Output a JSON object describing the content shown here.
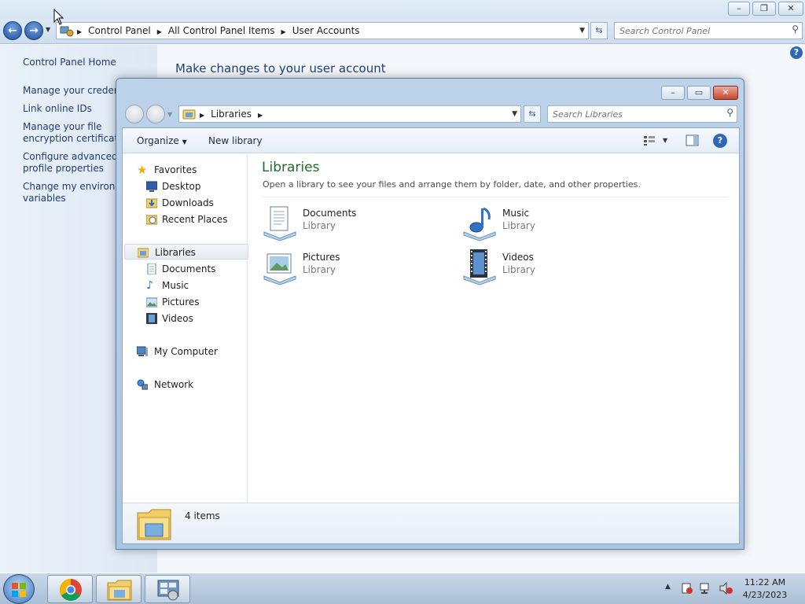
{
  "control_panel": {
    "breadcrumbs": [
      "Control Panel",
      "All Control Panel Items",
      "User Accounts"
    ],
    "search_placeholder": "Search Control Panel",
    "sidebar": {
      "home": "Control Panel Home",
      "links": [
        "Manage your credentials",
        "Link online IDs",
        "Manage your file encryption certificates",
        "Configure advanced user profile properties",
        "Change my environment variables"
      ]
    },
    "main_title": "Make changes to your user account"
  },
  "libraries_window": {
    "breadcrumbs": [
      "Libraries"
    ],
    "search_placeholder": "Search Libraries",
    "toolbar": {
      "organize": "Organize",
      "new_library": "New library"
    },
    "nav": {
      "favorites": {
        "label": "Favorites",
        "items": [
          "Desktop",
          "Downloads",
          "Recent Places"
        ]
      },
      "libraries": {
        "label": "Libraries",
        "items": [
          "Documents",
          "Music",
          "Pictures",
          "Videos"
        ]
      },
      "computer": "My Computer",
      "network": "Network"
    },
    "content": {
      "title": "Libraries",
      "subtitle": "Open a library to see your files and arrange them by folder, date, and other properties.",
      "items": [
        {
          "name": "Documents",
          "kind": "Library"
        },
        {
          "name": "Music",
          "kind": "Library"
        },
        {
          "name": "Pictures",
          "kind": "Library"
        },
        {
          "name": "Videos",
          "kind": "Library"
        }
      ]
    },
    "details": {
      "count": "4 items"
    }
  },
  "taskbar": {
    "time": "11:22 AM",
    "date": "4/23/2023"
  }
}
